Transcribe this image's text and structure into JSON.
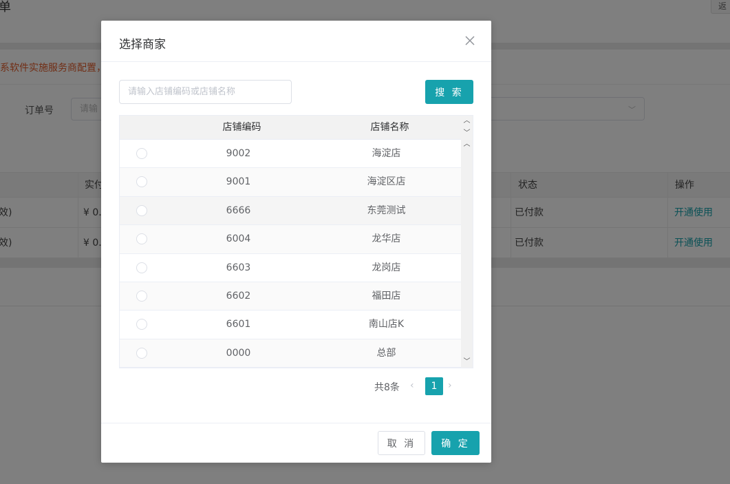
{
  "background": {
    "page_title": "单",
    "top_button": "返",
    "notice": "系软件实施服务商配置，",
    "filter_label": "订单号",
    "filter_placeholder": "请输",
    "table_headers": {
      "actual": "实付",
      "status": "状态",
      "action": "操作"
    },
    "rows": [
      {
        "col1": "效)",
        "actual": "¥ 0.",
        "status": "已付款",
        "action": "开通使用"
      },
      {
        "col1": "效)",
        "actual": "¥ 0.",
        "status": "已付款",
        "action": "开通使用"
      }
    ]
  },
  "dialog": {
    "title": "选择商家",
    "close_icon": "close-icon",
    "search": {
      "placeholder": "请输入店铺编码或店铺名称",
      "value": "",
      "button": "搜 索"
    },
    "table": {
      "headers": {
        "code": "店铺编码",
        "name": "店铺名称"
      },
      "rows": [
        {
          "code": "9002",
          "name": "海淀店"
        },
        {
          "code": "9001",
          "name": "海淀区店"
        },
        {
          "code": "6666",
          "name": "东莞测试"
        },
        {
          "code": "6004",
          "name": "龙华店"
        },
        {
          "code": "6603",
          "name": "龙岗店"
        },
        {
          "code": "6602",
          "name": "福田店"
        },
        {
          "code": "6601",
          "name": "南山店K"
        },
        {
          "code": "0000",
          "name": "总部"
        }
      ]
    },
    "pagination": {
      "total": "共8条",
      "current_page": "1",
      "prev": "‹",
      "next": "›"
    },
    "footer": {
      "cancel": "取 消",
      "confirm": "确 定"
    }
  },
  "colors": {
    "accent": "#17a2ad",
    "notice": "#e25c2a",
    "overlay": "rgba(0,0,0,0.5)"
  }
}
